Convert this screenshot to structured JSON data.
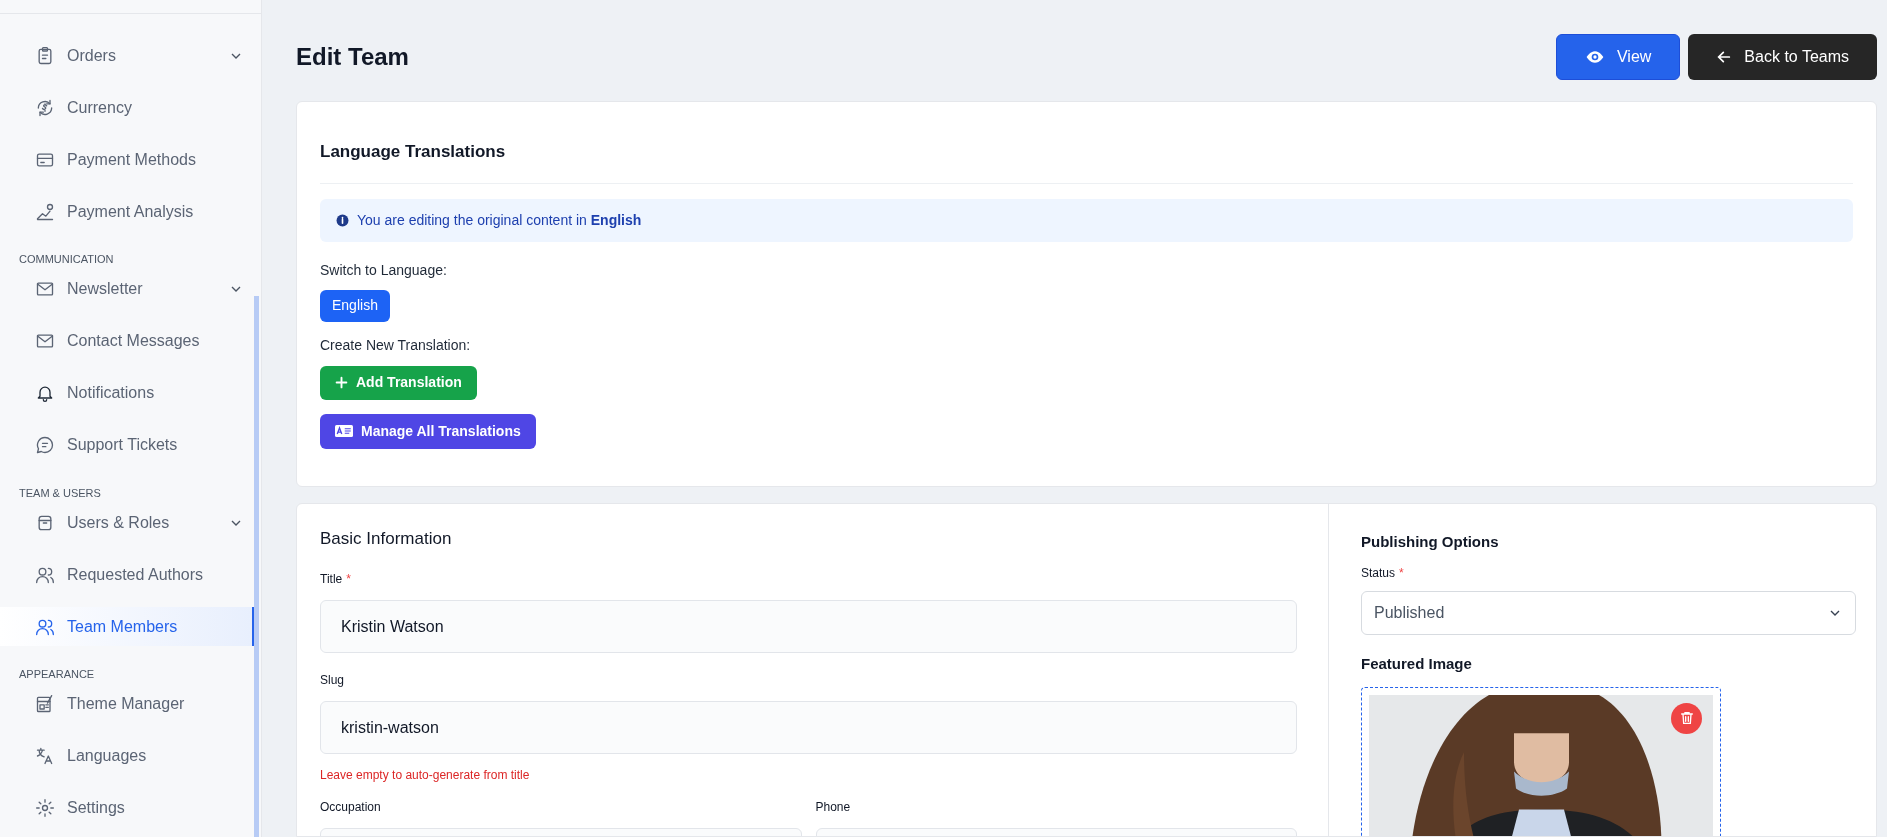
{
  "sidebar": {
    "sections": [
      {
        "items": [
          {
            "label": "Orders",
            "expandable": true,
            "selected": false
          },
          {
            "label": "Currency",
            "expandable": false,
            "selected": false
          },
          {
            "label": "Payment Methods",
            "expandable": false,
            "selected": false
          },
          {
            "label": "Payment Analysis",
            "expandable": false,
            "selected": false
          }
        ]
      },
      {
        "heading": "COMMUNICATION",
        "items": [
          {
            "label": "Newsletter",
            "expandable": true,
            "selected": false
          },
          {
            "label": "Contact Messages",
            "expandable": false,
            "selected": false
          },
          {
            "label": "Notifications",
            "expandable": false,
            "selected": false
          },
          {
            "label": "Support Tickets",
            "expandable": false,
            "selected": false
          }
        ]
      },
      {
        "heading": "TEAM & USERS",
        "items": [
          {
            "label": "Users & Roles",
            "expandable": true,
            "selected": false
          },
          {
            "label": "Requested Authors",
            "expandable": false,
            "selected": false
          },
          {
            "label": "Team Members",
            "expandable": false,
            "selected": true
          }
        ]
      },
      {
        "heading": "APPEARANCE",
        "items": [
          {
            "label": "Theme Manager",
            "expandable": false,
            "selected": false
          },
          {
            "label": "Languages",
            "expandable": false,
            "selected": false
          },
          {
            "label": "Settings",
            "expandable": false,
            "selected": false
          }
        ]
      }
    ]
  },
  "page": {
    "title": "Edit Team",
    "actions": [
      {
        "label": "View",
        "kind": "primary"
      },
      {
        "label": "Back to Teams",
        "kind": "dark"
      }
    ]
  },
  "translations": {
    "title": "Language Translations",
    "notice": "You are editing the original content in **English**",
    "switch_label": "Switch to Language:",
    "languages": [
      {
        "label": "English",
        "selected": true
      }
    ],
    "create_label": "Create New Translation:",
    "add_button": "Add Translation",
    "manage_button": "Manage All Translations"
  },
  "basic_info": {
    "title": "Basic Information",
    "fields": [
      {
        "label": "Title",
        "required_mark": "*",
        "value": "Kristin Watson"
      },
      {
        "label": "Slug",
        "value": "kristin-watson",
        "help": "Leave empty to auto-generate from title"
      }
    ],
    "pair": [
      {
        "label": "Occupation"
      },
      {
        "label": "Phone"
      }
    ]
  },
  "publishing": {
    "title": "Publishing Options",
    "status_label": "Status",
    "status_required_mark": "*",
    "status_value": "Published",
    "image_title": "Featured Image"
  }
}
